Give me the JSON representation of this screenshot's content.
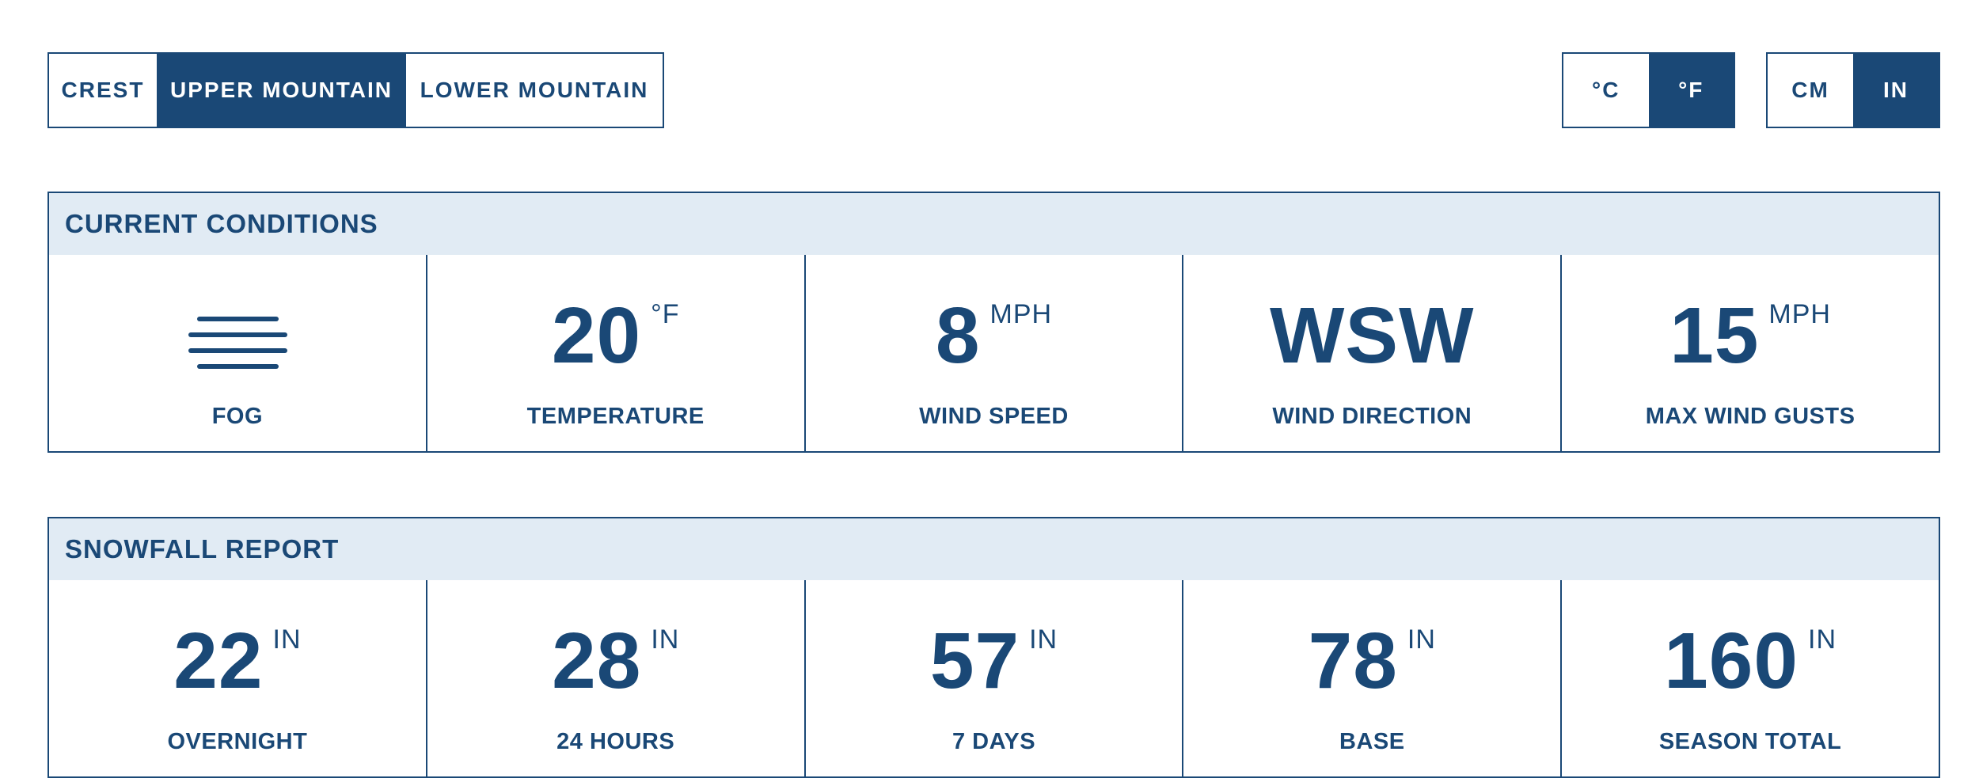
{
  "location_toggle": {
    "options": [
      "Crest",
      "Upper Mountain",
      "Lower Mountain"
    ],
    "selected": "Upper Mountain"
  },
  "temp_unit_toggle": {
    "options": [
      "°C",
      "°F"
    ],
    "selected": "°F"
  },
  "length_unit_toggle": {
    "options": [
      "CM",
      "IN"
    ],
    "selected": "IN"
  },
  "current_conditions": {
    "title": "Current Conditions",
    "weather": {
      "icon": "fog-icon",
      "label": "Fog"
    },
    "temperature": {
      "value": "20",
      "unit": "°F",
      "label": "Temperature"
    },
    "wind_speed": {
      "value": "8",
      "unit": "MPH",
      "label": "Wind Speed"
    },
    "wind_direction": {
      "value": "WSW",
      "label": "Wind Direction"
    },
    "max_wind_gusts": {
      "value": "15",
      "unit": "MPH",
      "label": "Max Wind Gusts"
    }
  },
  "snowfall_report": {
    "title": "Snowfall Report",
    "items": [
      {
        "value": "22",
        "unit": "IN",
        "label": "Overnight"
      },
      {
        "value": "28",
        "unit": "IN",
        "label": "24 Hours"
      },
      {
        "value": "57",
        "unit": "IN",
        "label": "7 Days"
      },
      {
        "value": "78",
        "unit": "IN",
        "label": "Base"
      },
      {
        "value": "160",
        "unit": "IN",
        "label": "Season Total"
      }
    ]
  },
  "colors": {
    "primary": "#1a4876",
    "header_bg": "#e1ebf4",
    "background": "#ffffff"
  }
}
